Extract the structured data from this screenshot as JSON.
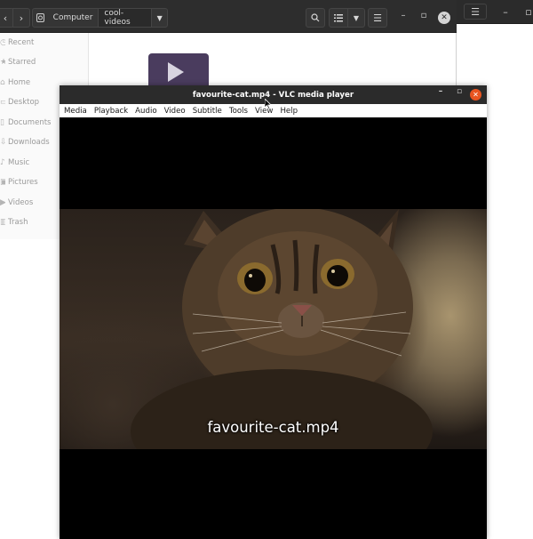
{
  "background_window": {
    "menu_icon": "hamburger-icon",
    "minimize_icon": "minimize-icon",
    "maximize_icon": "maximize-icon"
  },
  "files": {
    "path": {
      "home_icon": "drive-icon",
      "crumbs": [
        "Computer",
        "cool-videos"
      ]
    },
    "sidebar": [
      {
        "label": "Recent",
        "icon": "clock-icon"
      },
      {
        "label": "Starred",
        "icon": "star-icon"
      },
      {
        "label": "Home",
        "icon": "home-icon"
      },
      {
        "label": "Desktop",
        "icon": "desktop-icon"
      },
      {
        "label": "Documents",
        "icon": "document-icon"
      },
      {
        "label": "Downloads",
        "icon": "download-icon"
      },
      {
        "label": "Music",
        "icon": "music-icon"
      },
      {
        "label": "Pictures",
        "icon": "picture-icon"
      },
      {
        "label": "Videos",
        "icon": "video-icon"
      },
      {
        "label": "Trash",
        "icon": "trash-icon"
      }
    ]
  },
  "vlc": {
    "title": "favourite-cat.mp4 - VLC media player",
    "menu": [
      "Media",
      "Playback",
      "Audio",
      "Video",
      "Subtitle",
      "Tools",
      "View",
      "Help"
    ],
    "subtitle": "favourite-cat.mp4",
    "close_color": "#e9541f"
  }
}
